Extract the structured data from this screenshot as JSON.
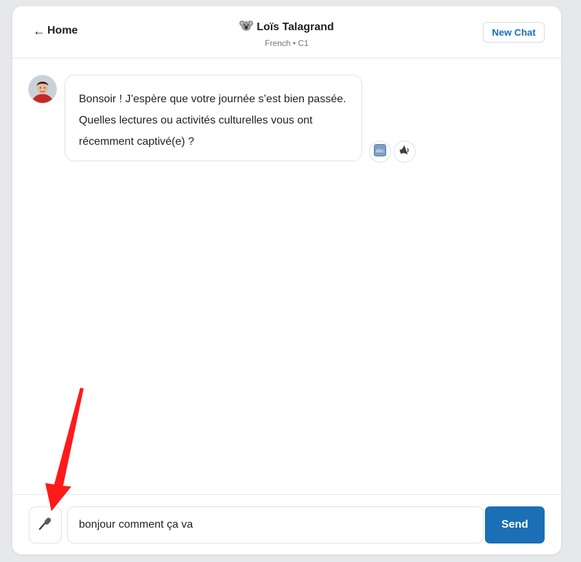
{
  "header": {
    "back_label": "Home",
    "title": "Loïs Talagrand",
    "title_icon": "koala-icon",
    "subtitle": "French • C1",
    "new_chat_label": "New Chat"
  },
  "messages": [
    {
      "role": "assistant",
      "avatar": "avatar-man-red-shirt",
      "text": "Bonsoir ! J’espère que votre journée s’est bien passée. Quelles lectures ou activités culturelles vous ont récemment captivé(e) ?",
      "actions": [
        "abc-translate-icon",
        "speaker-icon"
      ]
    }
  ],
  "composer": {
    "mic_icon": "microphone-icon",
    "input_value": "bonjour comment ça va",
    "send_label": "Send"
  },
  "colors": {
    "accent": "#1a6fb5",
    "background": "#e7e8ec",
    "annotation_arrow": "#ff0000"
  }
}
